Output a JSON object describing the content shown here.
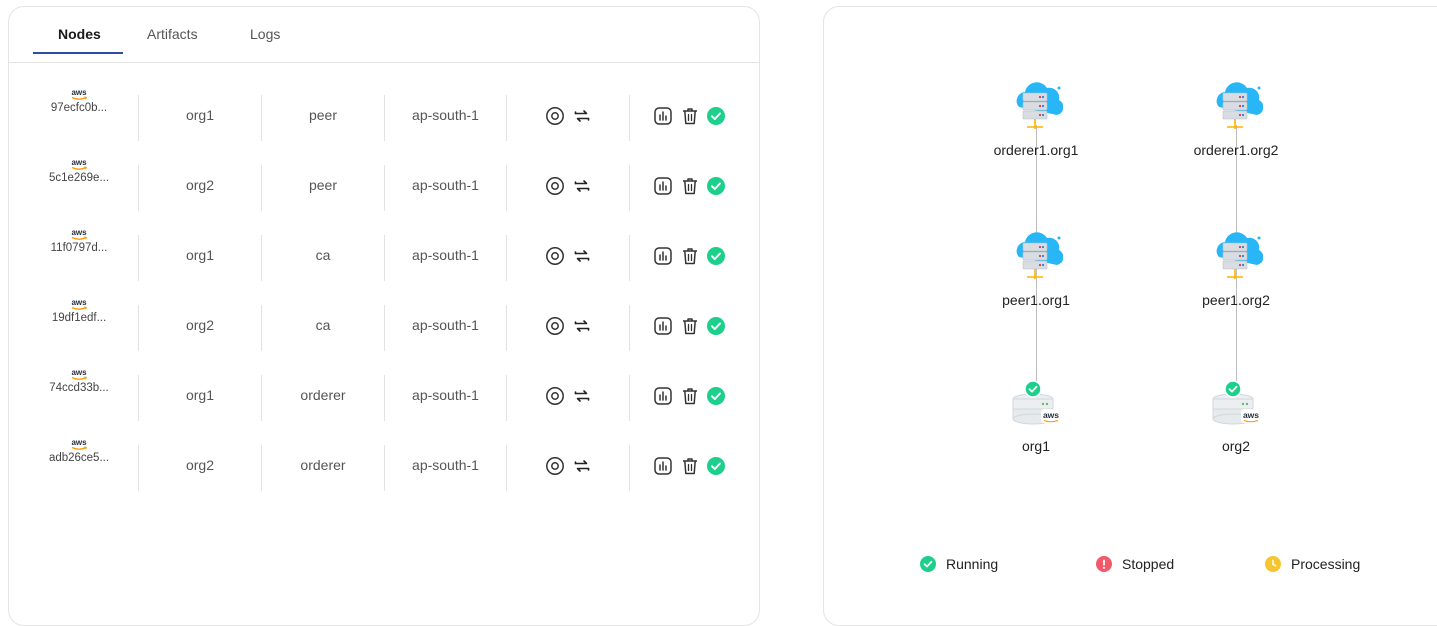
{
  "tabs": [
    {
      "label": "Nodes",
      "active": true
    },
    {
      "label": "Artifacts",
      "active": false
    },
    {
      "label": "Logs",
      "active": false
    }
  ],
  "provider_logo": "aws",
  "nodes": [
    {
      "id": "97ecfc0b...",
      "org": "org1",
      "type": "peer",
      "region": "ap-south-1",
      "status": "running"
    },
    {
      "id": "5c1e269e...",
      "org": "org2",
      "type": "peer",
      "region": "ap-south-1",
      "status": "running"
    },
    {
      "id": "11f0797d...",
      "org": "org1",
      "type": "ca",
      "region": "ap-south-1",
      "status": "running"
    },
    {
      "id": "19df1edf...",
      "org": "org2",
      "type": "ca",
      "region": "ap-south-1",
      "status": "running"
    },
    {
      "id": "74ccd33b...",
      "org": "org1",
      "type": "orderer",
      "region": "ap-south-1",
      "status": "running"
    },
    {
      "id": "adb26ce5...",
      "org": "org2",
      "type": "orderer",
      "region": "ap-south-1",
      "status": "running"
    }
  ],
  "row_actions": [
    "target-icon",
    "sync-icon",
    "chart-icon",
    "trash-icon",
    "status-check-icon"
  ],
  "topology": {
    "columns": [
      {
        "orderer": "orderer1.org1",
        "peer": "peer1.org1",
        "org": "org1",
        "org_badge": "aws"
      },
      {
        "orderer": "orderer1.org2",
        "peer": "peer1.org2",
        "org": "org2",
        "org_badge": "aws"
      }
    ]
  },
  "legend": [
    {
      "label": "Running",
      "color": "#1ccf8a"
    },
    {
      "label": "Stopped",
      "color": "#f2596a"
    },
    {
      "label": "Processing",
      "color": "#f7c62f"
    }
  ],
  "colors": {
    "running": "#1ccf8a",
    "stopped": "#f2596a",
    "processing": "#f7c62f",
    "tab_accent": "#2f4ea3",
    "cloud": "#29b6f6",
    "aws_orange": "#ff9900"
  }
}
